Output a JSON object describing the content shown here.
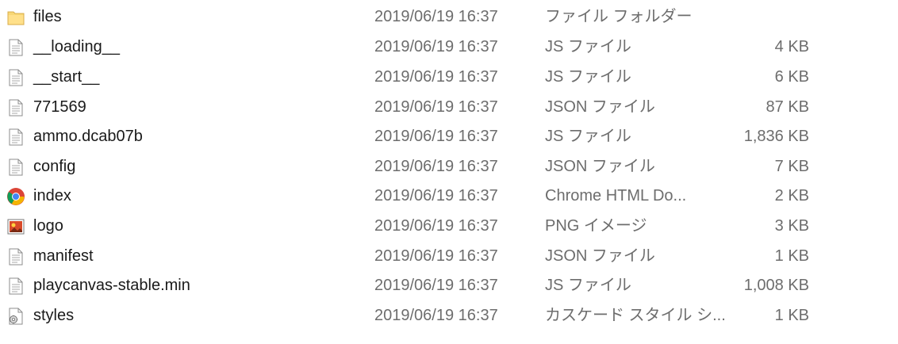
{
  "files": [
    {
      "name": "files",
      "date": "2019/06/19 16:37",
      "type": "ファイル フォルダー",
      "size": "",
      "icon": "folder-icon"
    },
    {
      "name": "__loading__",
      "date": "2019/06/19 16:37",
      "type": "JS ファイル",
      "size": "4 KB",
      "icon": "document-icon"
    },
    {
      "name": "__start__",
      "date": "2019/06/19 16:37",
      "type": "JS ファイル",
      "size": "6 KB",
      "icon": "document-icon"
    },
    {
      "name": "771569",
      "date": "2019/06/19 16:37",
      "type": "JSON ファイル",
      "size": "87 KB",
      "icon": "document-icon"
    },
    {
      "name": "ammo.dcab07b",
      "date": "2019/06/19 16:37",
      "type": "JS ファイル",
      "size": "1,836 KB",
      "icon": "document-icon"
    },
    {
      "name": "config",
      "date": "2019/06/19 16:37",
      "type": "JSON ファイル",
      "size": "7 KB",
      "icon": "document-icon"
    },
    {
      "name": "index",
      "date": "2019/06/19 16:37",
      "type": "Chrome HTML Do...",
      "size": "2 KB",
      "icon": "chrome-icon"
    },
    {
      "name": "logo",
      "date": "2019/06/19 16:37",
      "type": "PNG イメージ",
      "size": "3 KB",
      "icon": "image-icon"
    },
    {
      "name": "manifest",
      "date": "2019/06/19 16:37",
      "type": "JSON ファイル",
      "size": "1 KB",
      "icon": "document-icon"
    },
    {
      "name": "playcanvas-stable.min",
      "date": "2019/06/19 16:37",
      "type": "JS ファイル",
      "size": "1,008 KB",
      "icon": "document-icon"
    },
    {
      "name": "styles",
      "date": "2019/06/19 16:37",
      "type": "カスケード スタイル シ...",
      "size": "1 KB",
      "icon": "stylesheet-icon"
    }
  ]
}
